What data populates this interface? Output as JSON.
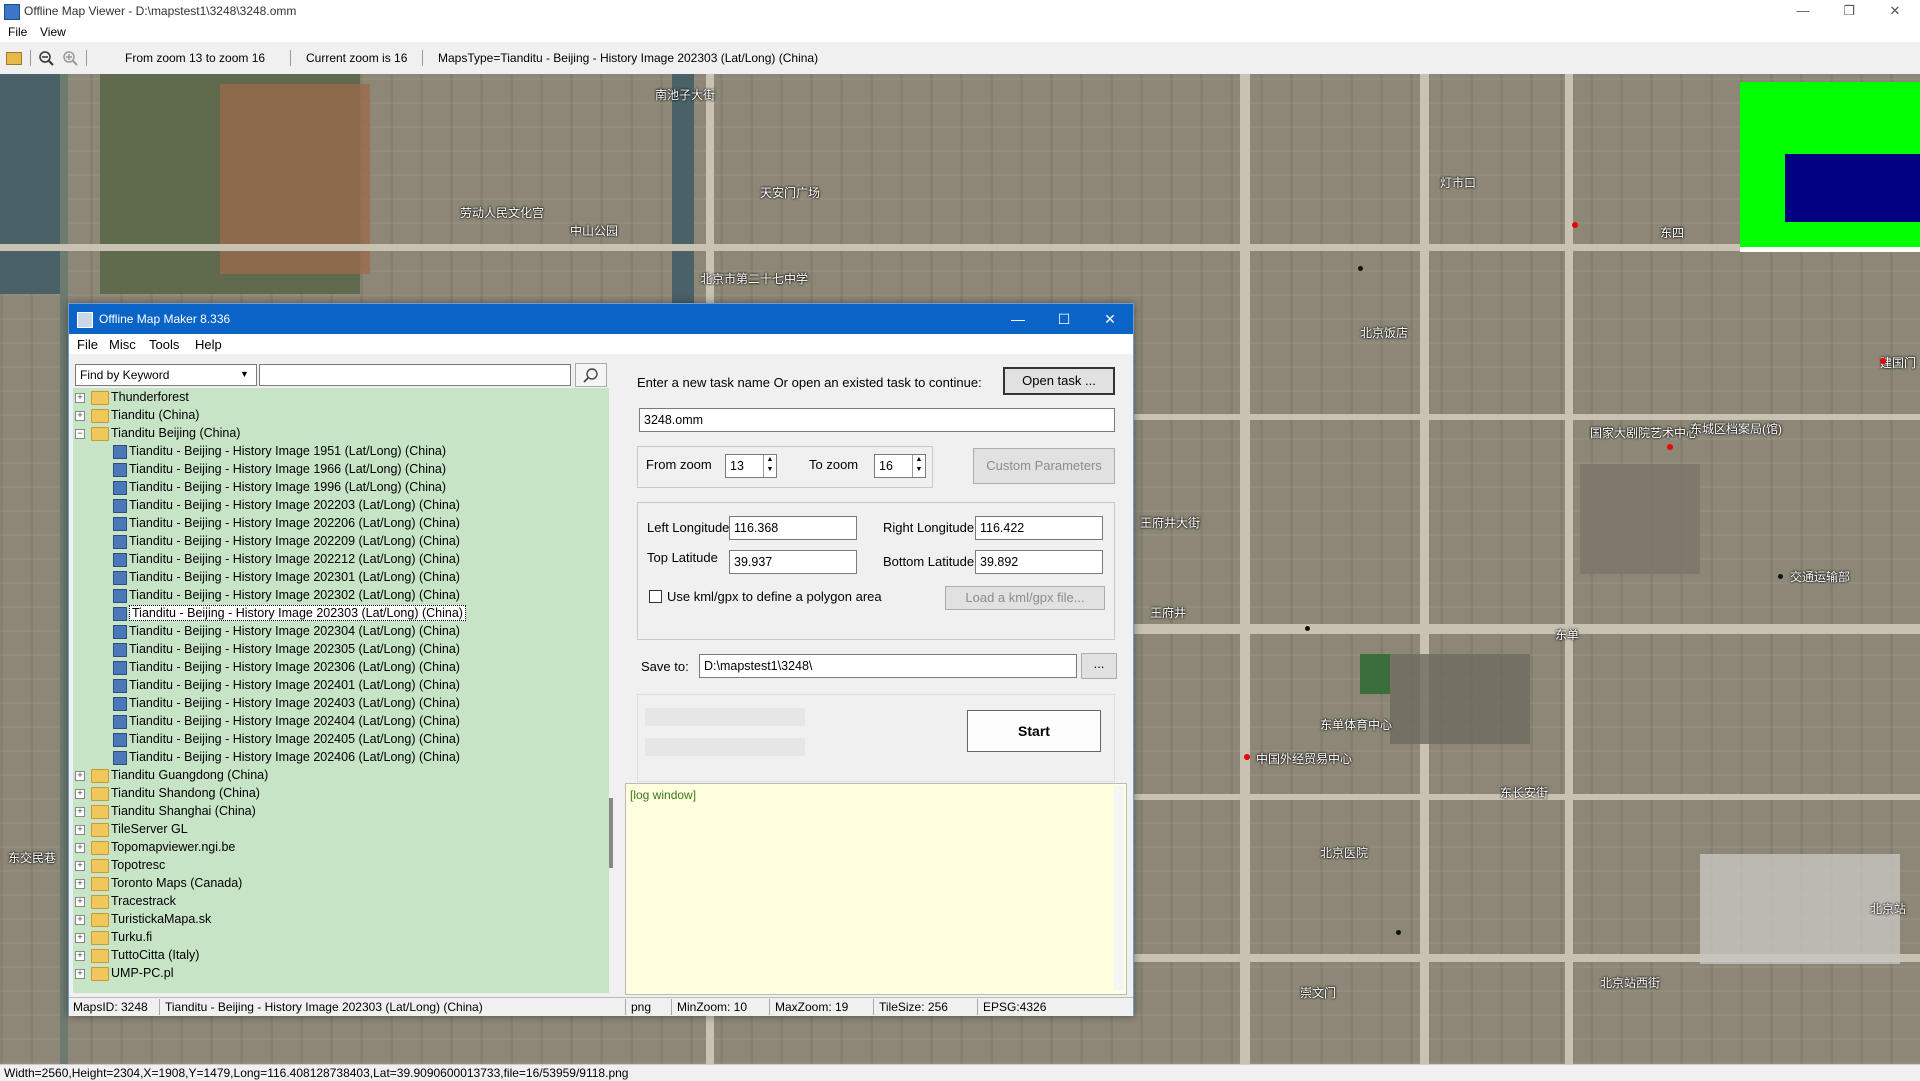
{
  "viewer": {
    "title": "Offline Map Viewer - D:\\mapstest1\\3248\\3248.omm",
    "menu": [
      "File",
      "View"
    ],
    "toolbar": {
      "zoom_range": "From zoom 13 to zoom 16",
      "current_zoom": "Current zoom is 16",
      "maps_type": "MapsType=Tianditu - Beijing - History Image 202303 (Lat/Long) (China)"
    },
    "status": "Width=2560,Height=2304,X=1908,Y=1479,Long=116.408128738403,Lat=39.9090600013733,file=16/53959/9118.png",
    "minimap_colors": {
      "frame": "#00ff00",
      "view": "#000080"
    }
  },
  "map_labels": [
    "南池子大街",
    "天安门广场",
    "劳动人民文化宫",
    "中山公园",
    "北京饭店",
    "王府井大街",
    "东单",
    "灯市口",
    "东四",
    "建国门",
    "北京站",
    "东长安街",
    "崇文门",
    "东交民巷",
    "王府井",
    "北京市第二十七中学",
    "交通运输部",
    "中国外经贸易中心",
    "北京医院",
    "东单体育中心",
    "北京站西街",
    "国家大剧院艺术中心",
    "东城区档案局(馆)"
  ],
  "dialog": {
    "title": "Offline Map Maker 8.336",
    "menu": [
      "File",
      "Misc",
      "Tools",
      "Help"
    ],
    "find_mode": "Find by Keyword",
    "search_value": "",
    "tree": [
      {
        "label": "Thunderforest",
        "type": "folder",
        "expanded": false
      },
      {
        "label": "Tianditu (China)",
        "type": "folder",
        "expanded": false
      },
      {
        "label": "Tianditu Beijing (China)",
        "type": "folder",
        "expanded": true
      },
      {
        "label": "Tianditu - Beijing - History Image 1951 (Lat/Long) (China)",
        "type": "map"
      },
      {
        "label": "Tianditu - Beijing - History Image 1966 (Lat/Long) (China)",
        "type": "map"
      },
      {
        "label": "Tianditu - Beijing - History Image 1996 (Lat/Long) (China)",
        "type": "map"
      },
      {
        "label": "Tianditu - Beijing - History Image 202203 (Lat/Long) (China)",
        "type": "map"
      },
      {
        "label": "Tianditu - Beijing - History Image 202206 (Lat/Long) (China)",
        "type": "map"
      },
      {
        "label": "Tianditu - Beijing - History Image 202209 (Lat/Long) (China)",
        "type": "map"
      },
      {
        "label": "Tianditu - Beijing - History Image 202212 (Lat/Long) (China)",
        "type": "map"
      },
      {
        "label": "Tianditu - Beijing - History Image 202301 (Lat/Long) (China)",
        "type": "map"
      },
      {
        "label": "Tianditu - Beijing - History Image 202302 (Lat/Long) (China)",
        "type": "map"
      },
      {
        "label": "Tianditu - Beijing - History Image 202303 (Lat/Long) (China)",
        "type": "map",
        "selected": true
      },
      {
        "label": "Tianditu - Beijing - History Image 202304 (Lat/Long) (China)",
        "type": "map"
      },
      {
        "label": "Tianditu - Beijing - History Image 202305 (Lat/Long) (China)",
        "type": "map"
      },
      {
        "label": "Tianditu - Beijing - History Image 202306 (Lat/Long) (China)",
        "type": "map"
      },
      {
        "label": "Tianditu - Beijing - History Image 202401 (Lat/Long) (China)",
        "type": "map"
      },
      {
        "label": "Tianditu - Beijing - History Image 202403 (Lat/Long) (China)",
        "type": "map"
      },
      {
        "label": "Tianditu - Beijing - History Image 202404 (Lat/Long) (China)",
        "type": "map"
      },
      {
        "label": "Tianditu - Beijing - History Image 202405 (Lat/Long) (China)",
        "type": "map"
      },
      {
        "label": "Tianditu - Beijing - History Image 202406 (Lat/Long) (China)",
        "type": "map"
      },
      {
        "label": "Tianditu Guangdong (China)",
        "type": "folder",
        "expanded": false
      },
      {
        "label": "Tianditu Shandong (China)",
        "type": "folder",
        "expanded": false
      },
      {
        "label": "Tianditu Shanghai (China)",
        "type": "folder",
        "expanded": false
      },
      {
        "label": "TileServer GL",
        "type": "folder",
        "expanded": false
      },
      {
        "label": "Topomapviewer.ngi.be",
        "type": "folder",
        "expanded": false
      },
      {
        "label": "Topotresc",
        "type": "folder",
        "expanded": false
      },
      {
        "label": "Toronto Maps (Canada)",
        "type": "folder",
        "expanded": false
      },
      {
        "label": "Tracestrack",
        "type": "folder",
        "expanded": false
      },
      {
        "label": "TuristickaMapa.sk",
        "type": "folder",
        "expanded": false
      },
      {
        "label": "Turku.fi",
        "type": "folder",
        "expanded": false
      },
      {
        "label": "TuttoCitta (Italy)",
        "type": "folder",
        "expanded": false
      },
      {
        "label": "UMP-PC.pl",
        "type": "folder",
        "expanded": false
      }
    ],
    "task_prompt": "Enter a new task name Or open an existed task to continue:",
    "open_task_btn": "Open task ...",
    "task_name": "3248.omm",
    "from_zoom_label": "From zoom",
    "from_zoom": "13",
    "to_zoom_label": "To zoom",
    "to_zoom": "16",
    "custom_params_btn": "Custom Parameters",
    "left_lon_label": "Left Longitude",
    "left_lon": "116.368",
    "right_lon_label": "Right Longitude",
    "right_lon": "116.422",
    "top_lat_label": "Top Latitude",
    "top_lat": "39.937",
    "bottom_lat_label": "Bottom Latitude",
    "bottom_lat": "39.892",
    "kml_label": "Use kml/gpx to define a polygon area",
    "kml_checked": false,
    "load_kml_btn": "Load a kml/gpx file...",
    "save_to_label": "Save to:",
    "save_to": "D:\\mapstest1\\3248\\",
    "browse_btn": "...",
    "start_btn": "Start",
    "log": "[log window]",
    "status": {
      "maps_id": "MapsID: 3248",
      "maps_name": "Tianditu - Beijing - History Image 202303 (Lat/Long) (China)",
      "format": "png",
      "min_zoom": "MinZoom: 10",
      "max_zoom": "MaxZoom: 19",
      "tile_size": "TileSize: 256",
      "epsg": "EPSG:4326"
    }
  }
}
